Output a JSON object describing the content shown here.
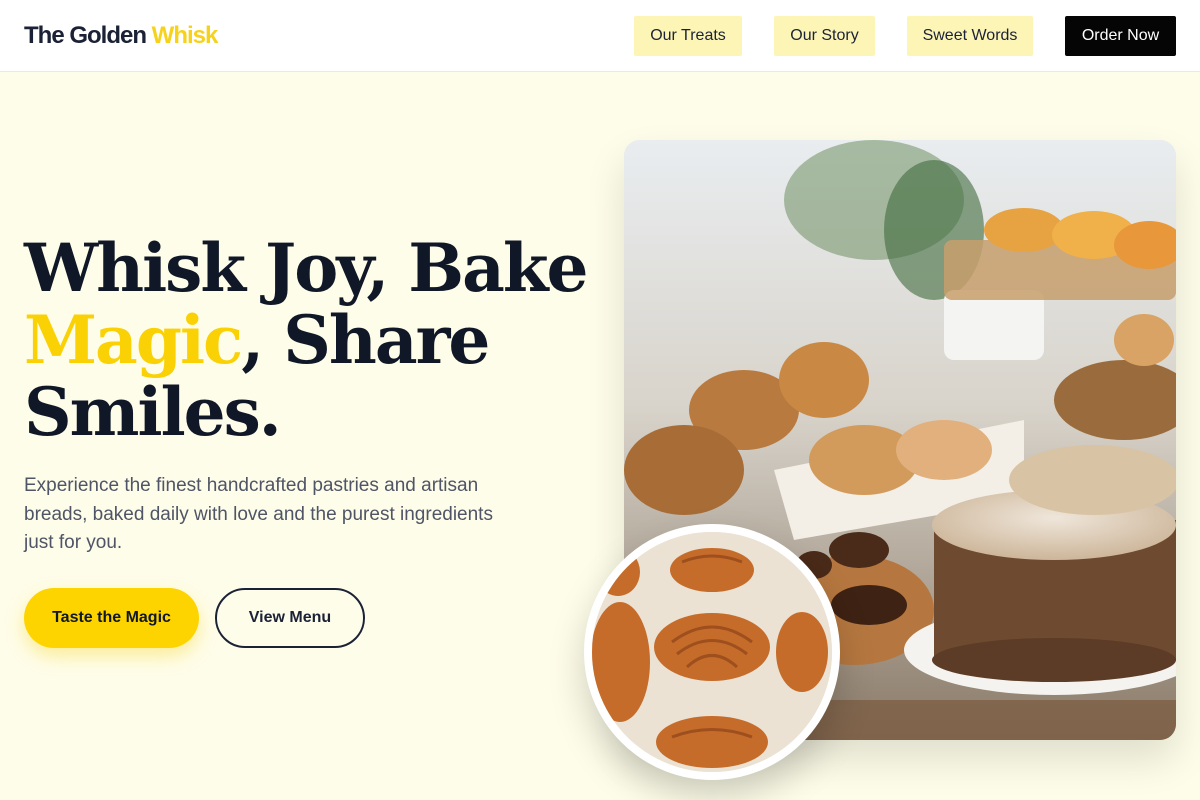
{
  "header": {
    "logo_main": "The Golden ",
    "logo_accent": "Whisk",
    "nav": [
      {
        "label": "Our Treats"
      },
      {
        "label": "Our Story"
      },
      {
        "label": "Sweet Words"
      }
    ],
    "order_label": "Order Now"
  },
  "hero": {
    "headline_part1": "Whisk Joy, Bake",
    "headline_accent": "Magic",
    "headline_part2": ", Share",
    "headline_part3": "Smiles.",
    "subtext": "Experience the finest handcrafted pastries and artisan breads, baked daily with love and the purest ingredients just for you.",
    "primary_cta": "Taste the Magic",
    "secondary_cta": "View Menu"
  },
  "colors": {
    "accent": "#f9d105",
    "dark": "#101828",
    "background": "#fefde9",
    "nav_pill": "#fdf5b5"
  }
}
